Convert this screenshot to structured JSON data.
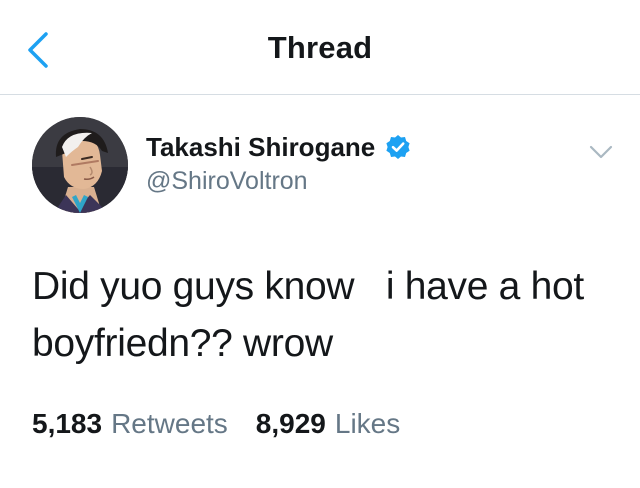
{
  "header": {
    "title": "Thread",
    "back_icon": "chevron-left-icon"
  },
  "tweet": {
    "author": {
      "display_name": "Takashi Shirogane",
      "handle": "@ShiroVoltron",
      "verified": true
    },
    "text": "Did yuo guys know   i have a hot\nboyfriedn?? wrow",
    "stats": {
      "retweets_count": "5,183",
      "retweets_label": "Retweets",
      "likes_count": "8,929",
      "likes_label": "Likes"
    }
  },
  "colors": {
    "accent": "#1da1f2",
    "text_primary": "#14171a",
    "text_secondary": "#657786",
    "divider": "#d6dde3"
  }
}
